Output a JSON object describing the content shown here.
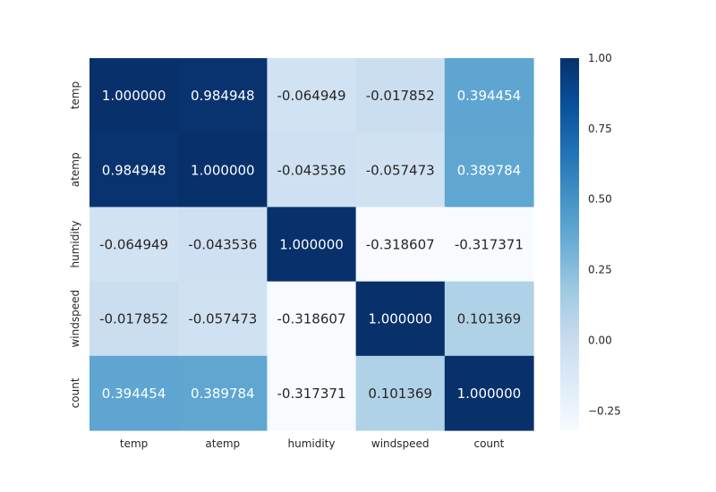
{
  "chart_data": {
    "type": "heatmap",
    "title": "",
    "xlabel": "",
    "ylabel": "",
    "rows": [
      "temp",
      "atemp",
      "humidity",
      "windspeed",
      "count"
    ],
    "columns": [
      "temp",
      "atemp",
      "humidity",
      "windspeed",
      "count"
    ],
    "values": [
      [
        1.0,
        0.984948,
        -0.064949,
        -0.017852,
        0.394454
      ],
      [
        0.984948,
        1.0,
        -0.043536,
        -0.057473,
        0.389784
      ],
      [
        -0.064949,
        -0.043536,
        1.0,
        -0.318607,
        -0.317371
      ],
      [
        -0.017852,
        -0.057473,
        -0.318607,
        1.0,
        0.101369
      ],
      [
        0.394454,
        0.389784,
        -0.317371,
        0.101369,
        1.0
      ]
    ],
    "value_labels": [
      [
        "1.000000",
        "0.984948",
        "-0.064949",
        "-0.017852",
        "0.394454"
      ],
      [
        "0.984948",
        "1.000000",
        "-0.043536",
        "-0.057473",
        "0.389784"
      ],
      [
        "-0.064949",
        "-0.043536",
        "1.000000",
        "-0.318607",
        "-0.317371"
      ],
      [
        "-0.017852",
        "-0.057473",
        "-0.318607",
        "1.000000",
        "0.101369"
      ],
      [
        "0.394454",
        "0.389784",
        "-0.317371",
        "0.101369",
        "1.000000"
      ]
    ],
    "colormap": "Blues",
    "color_range": [
      -0.318607,
      1.0
    ],
    "colorbar": {
      "ticks": [
        1.0,
        0.75,
        0.5,
        0.25,
        0.0,
        -0.25
      ],
      "tick_labels": [
        "1.00",
        "0.75",
        "0.50",
        "0.25",
        "0.00",
        "−0.25"
      ]
    },
    "annotation_colors": {
      "dark": "#262626",
      "light": "#ffffff"
    }
  }
}
